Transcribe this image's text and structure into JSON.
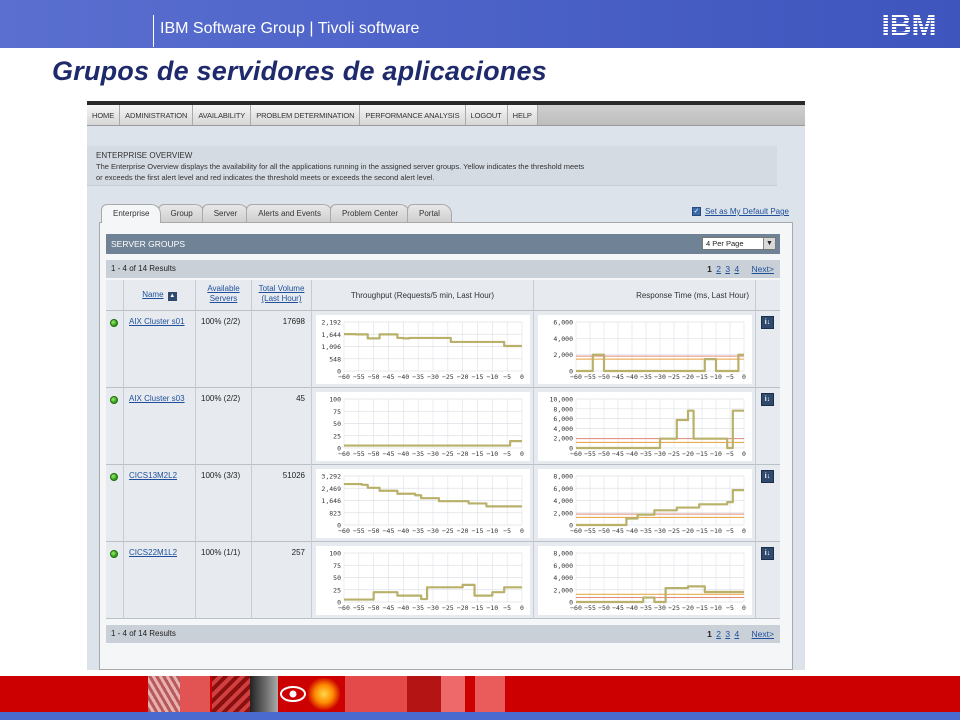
{
  "slide": {
    "header_text": "IBM Software Group | Tivoli software",
    "logo_text": "IBM",
    "title": "Grupos de servidores de aplicaciones"
  },
  "nav": [
    "HOME",
    "ADMINISTRATION",
    "AVAILABILITY",
    "PROBLEM DETERMINATION",
    "PERFORMANCE ANALYSIS",
    "LOGOUT",
    "HELP"
  ],
  "overview": {
    "title": "ENTERPRISE OVERVIEW",
    "text_1": "The Enterprise Overview displays the availability for all the applications running in the assigned server groups. Yellow indicates the threshold meets",
    "text_2": "or exceeds the first alert level and red indicates the threshold meets or exceeds the second alert level."
  },
  "tabs": [
    "Enterprise",
    "Group",
    "Server",
    "Alerts and Events",
    "Problem Center",
    "Portal"
  ],
  "default_page": {
    "checkmark": "✓",
    "label": "Set as My Default Page"
  },
  "server_groups": {
    "title": "SERVER GROUPS",
    "per_page": "4 Per Page",
    "dropdown_glyph": "▼",
    "results": "1 - 4 of 14 Results",
    "pager": {
      "current": "1",
      "pages": [
        "2",
        "3",
        "4"
      ],
      "next": "Next>"
    }
  },
  "columns": {
    "name": "Name",
    "sort_glyph": "▲",
    "available_1": "Available",
    "available_2": "Servers",
    "volume_1": "Total Volume",
    "volume_2": "(Last Hour)",
    "throughput": "Throughput (Requests/5 min, Last Hour)",
    "response": "Response Time (ms, Last Hour)"
  },
  "x_tick_labels": [
    "−60",
    "−55",
    "−50",
    "−45",
    "−40",
    "−35",
    "−30",
    "−25",
    "−20",
    "−15",
    "−10",
    "−5",
    "0"
  ],
  "rows": [
    {
      "name": "AIX Cluster s01",
      "available": "100% (2/2)",
      "volume": "17698",
      "action_glyph": "i↓",
      "throughput": {
        "ticks": [
          "2,192",
          "1,644",
          "1,096",
          "548",
          "0"
        ],
        "ymax": 2192,
        "values": [
          1650,
          1650,
          1640,
          1640,
          1460,
          1460,
          1640,
          1640,
          1640,
          1480,
          1460,
          1480,
          1480,
          1480,
          1480,
          1480,
          1480,
          1480,
          1300,
          1300,
          1300,
          1300,
          1300,
          1300,
          1300,
          1300,
          1300,
          1120,
          1120,
          1120,
          1120
        ],
        "warn": null,
        "crit": null
      },
      "response": {
        "ticks": [
          "6,000",
          "4,000",
          "2,000",
          "0"
        ],
        "ymax": 6600,
        "values": [
          0,
          0,
          0,
          2200,
          2200,
          0,
          0,
          0,
          0,
          0,
          0,
          0,
          0,
          0,
          0,
          0,
          0,
          0,
          0,
          0,
          0,
          0,
          0,
          1600,
          1600,
          0,
          0,
          0,
          0,
          2200,
          2200
        ],
        "warn": 1600,
        "crit": 2000
      }
    },
    {
      "name": "AIX Cluster s03",
      "available": "100% (2/2)",
      "volume": "45",
      "action_glyph": "i↓",
      "throughput": {
        "ticks": [
          "100",
          "75",
          "50",
          "25",
          "0"
        ],
        "ymax": 100,
        "values": [
          5,
          5,
          5,
          5,
          5,
          5,
          5,
          5,
          5,
          5,
          5,
          5,
          5,
          5,
          5,
          5,
          5,
          5,
          5,
          5,
          5,
          5,
          5,
          5,
          5,
          5,
          5,
          5,
          14,
          14,
          14
        ],
        "warn": null,
        "crit": null
      },
      "response": {
        "ticks": [
          "10,000",
          "8,000",
          "6,000",
          "4,000",
          "2,000",
          "0"
        ],
        "ymax": 10500,
        "values": [
          0,
          0,
          0,
          0,
          0,
          0,
          0,
          0,
          0,
          0,
          0,
          0,
          0,
          0,
          0,
          2000,
          2000,
          2000,
          6000,
          6000,
          8000,
          2000,
          2000,
          2000,
          2000,
          2000,
          2000,
          0,
          8000,
          8000,
          8000
        ],
        "warn": 1200,
        "crit": 2000
      }
    },
    {
      "name": "CICS13M2L2",
      "available": "100% (3/3)",
      "volume": "51026",
      "action_glyph": "i↓",
      "throughput": {
        "ticks": [
          "3,292",
          "2,469",
          "1,646",
          "823",
          "0"
        ],
        "ymax": 3292,
        "values": [
          2750,
          2750,
          2750,
          2700,
          2500,
          2500,
          2300,
          2300,
          2300,
          2100,
          2100,
          2100,
          2000,
          1800,
          1800,
          1800,
          1600,
          1600,
          1600,
          1600,
          1600,
          1450,
          1450,
          1450,
          1250,
          1250,
          1250,
          1250,
          1250,
          1250,
          1250
        ],
        "warn": null,
        "crit": null
      },
      "response": {
        "ticks": [
          "8,000",
          "6,000",
          "4,000",
          "2,000",
          "0"
        ],
        "ymax": 9000,
        "values": [
          0,
          0,
          0,
          0,
          0,
          0,
          0,
          0,
          0,
          1200,
          1200,
          1900,
          1900,
          1900,
          2700,
          2700,
          2700,
          2700,
          3200,
          3200,
          3200,
          3200,
          3800,
          3800,
          3800,
          3800,
          3800,
          4200,
          6400,
          6400,
          6400
        ],
        "warn": 1400,
        "crit": 2000
      }
    },
    {
      "name": "CICS22M1L2",
      "available": "100% (1/1)",
      "volume": "257",
      "action_glyph": "i↓",
      "throughput": {
        "ticks": [
          "100",
          "75",
          "50",
          "25",
          "0"
        ],
        "ymax": 100,
        "values": [
          5,
          5,
          5,
          5,
          5,
          20,
          20,
          20,
          20,
          13,
          13,
          13,
          13,
          6,
          30,
          30,
          30,
          30,
          30,
          30,
          35,
          35,
          13,
          13,
          13,
          20,
          20,
          30,
          30,
          30,
          30
        ],
        "warn": null,
        "crit": null
      },
      "response": {
        "ticks": [
          "8,000",
          "6,000",
          "4,000",
          "2,000",
          "0"
        ],
        "ymax": 8800,
        "values": [
          0,
          0,
          0,
          0,
          0,
          0,
          0,
          0,
          0,
          0,
          0,
          0,
          800,
          800,
          0,
          0,
          2500,
          2500,
          2500,
          2500,
          2800,
          2800,
          2800,
          1800,
          1800,
          1800,
          1800,
          1800,
          1800,
          1800,
          1800
        ],
        "warn": 1400,
        "crit": 800
      }
    }
  ],
  "colors": {
    "series": "#b9b06a",
    "warn": "#e7a13a",
    "crit": "#e38a7a",
    "grid": "#dde1e6"
  }
}
